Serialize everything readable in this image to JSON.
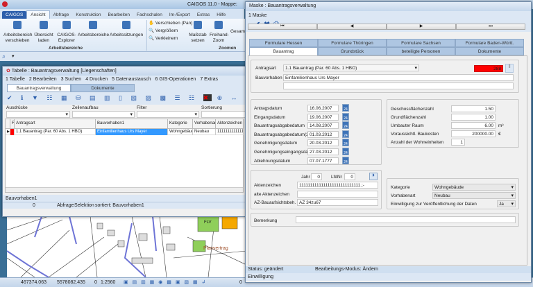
{
  "app": {
    "title": "CAIGOS 11.0  -  Mappe:"
  },
  "ribbon": {
    "tabs": [
      "CAIGOS",
      "Ansicht",
      "Abfrage",
      "Konstruktion",
      "Bearbeiten",
      "Fachschalen",
      "Im-/Export",
      "Extras",
      "Hilfe"
    ],
    "active_tab": "Ansicht",
    "buttons": [
      {
        "label": "Arbeitsbereich verschieben"
      },
      {
        "label": "Übersicht laden"
      },
      {
        "label": "CAIGOS-Explorer"
      },
      {
        "label": "Arbeitsbereiche"
      },
      {
        "label": "Arbeitssitzungen"
      },
      {
        "label": "Verschieben (Pan)"
      },
      {
        "label": "Vergrößern"
      },
      {
        "label": "Verkleinern"
      },
      {
        "label": "Maßstab setzen"
      },
      {
        "label": "Freihand-Zoom"
      },
      {
        "label": "Gesam"
      }
    ],
    "groups": [
      "Arbeitsbereiche",
      "Zoomen"
    ]
  },
  "table_window": {
    "title": "Tabelle : Bauantragsverwaltung [Liegenschaften]",
    "menu": [
      "1 Tabelle",
      "2 Bearbeiten",
      "3 Suchen",
      "4 Drucken",
      "5 Datenaustausch",
      "6 GIS-Operationen",
      "7 Extras"
    ],
    "tabs": [
      "Bauantragsverwaltung",
      "Dokumente"
    ],
    "filters": [
      "Ausdrücke",
      "Zeilenaufbau",
      "Filter",
      "Sortierung"
    ],
    "columns": [
      "F",
      "Antragsart",
      "Bauvorhaben1",
      "Kategorie",
      "Vorhabenart",
      "Aktenzeichen",
      "Ak"
    ],
    "rows": [
      [
        "",
        "1.1 Bauantrag (Par. 60 Abs. 1 HBO)",
        "Einfamilienhaus Urs Mayer",
        "Wohngebäude",
        "Neubau",
        "1111111111111",
        ""
      ]
    ],
    "status_field": "Bauvorhaben1",
    "status": [
      "0",
      "Abfrage",
      "Selektion",
      "sortiert: Bauvorhaben1"
    ]
  },
  "map": {
    "labels": [
      "Planvertrag",
      "FLV"
    ],
    "colors": {
      "parcel_green": "#8fcf5a",
      "parcel_orange": "#f5a800",
      "road_blue": "#6e74d6"
    }
  },
  "main_status": {
    "x": "467374.063",
    "y": "5578082.435",
    "z": "0",
    "scale": "1:2560",
    "right": "0"
  },
  "mask": {
    "title": "Maske : Bauantragsverwaltung",
    "menu": "1 Maske",
    "nav": [
      "⏮",
      "◀",
      "▶",
      "⏭"
    ],
    "tabs_row1": [
      "Formulare Hessen",
      "Formulare Thüringen",
      "Formulare Sachsen",
      "Formulare Baden-Württ."
    ],
    "tabs_row2": [
      "Bauantrag",
      "Grundstück",
      "beteiligte Personen",
      "Dokumente"
    ],
    "antragsart": {
      "label": "Antragsart",
      "value": "1.1 Bauantrag (Par. 60 Abs. 1 HBO)",
      "badge": "288",
      "badge_color": "#ff0000"
    },
    "bauvorhaben": {
      "label": "Bauvorhaben",
      "value": "Einfamilienhaus Urs Mayer"
    },
    "dates": [
      {
        "label": "Antragsdatum",
        "value": "16.06.2007"
      },
      {
        "label": "Eingangsdatum",
        "value": "19.06.2007"
      },
      {
        "label": "Bauantragsabgabedatum",
        "value": "14.08.2007"
      },
      {
        "label": "Bauantragsabgabedatum(2)",
        "value": "01.03.2012"
      },
      {
        "label": "Genehmigungsdatum",
        "value": "20.03.2012"
      },
      {
        "label": "Genehmigungseingangsdatum",
        "value": "27.03.2012"
      },
      {
        "label": "Ablehnungsdatum",
        "value": "07.07.1777"
      }
    ],
    "cal_icon_text": "24",
    "numbers": [
      {
        "label": "Geschossflächenzahl",
        "value": "1.50",
        "unit": ""
      },
      {
        "label": "Grundflächenzahl",
        "value": "1.00",
        "unit": ""
      },
      {
        "label": "Umbauter Raum",
        "value": "6.00",
        "unit": "m³"
      },
      {
        "label": "Voraussichtl. Baukosten",
        "value": "200000.00",
        "unit": "€"
      },
      {
        "label": "Anzahl der Wohneinheiten",
        "value": "1",
        "unit": ""
      }
    ],
    "jahr": {
      "label": "Jahr",
      "value": "0"
    },
    "lfdnr": {
      "label": "LfdNr",
      "value": "0"
    },
    "aktenzeichen": {
      "label": "Aktenzeichen",
      "value": "1111111111111111111111111111.;-"
    },
    "alte_aktenzeichen": {
      "label": "alte Aktenzeichen",
      "value": ""
    },
    "az_bau": {
      "label": "AZ-Bauaufsichtsbeh.",
      "value": "AZ 34zu67"
    },
    "kategorie": {
      "label": "Kategorie",
      "value": "Wohngebäude"
    },
    "vorhabenart": {
      "label": "Vorhabenart",
      "value": "Neubau"
    },
    "einwilligung": {
      "label": "Einwilligung zur Veröffentlichung der Daten",
      "value": "Ja"
    },
    "bemerkung": {
      "label": "Bemerkung",
      "value": ""
    },
    "status": "Status: geändert",
    "mode": "Bearbeitungs-Modus: Ändern",
    "hint": "Einwilligung"
  }
}
